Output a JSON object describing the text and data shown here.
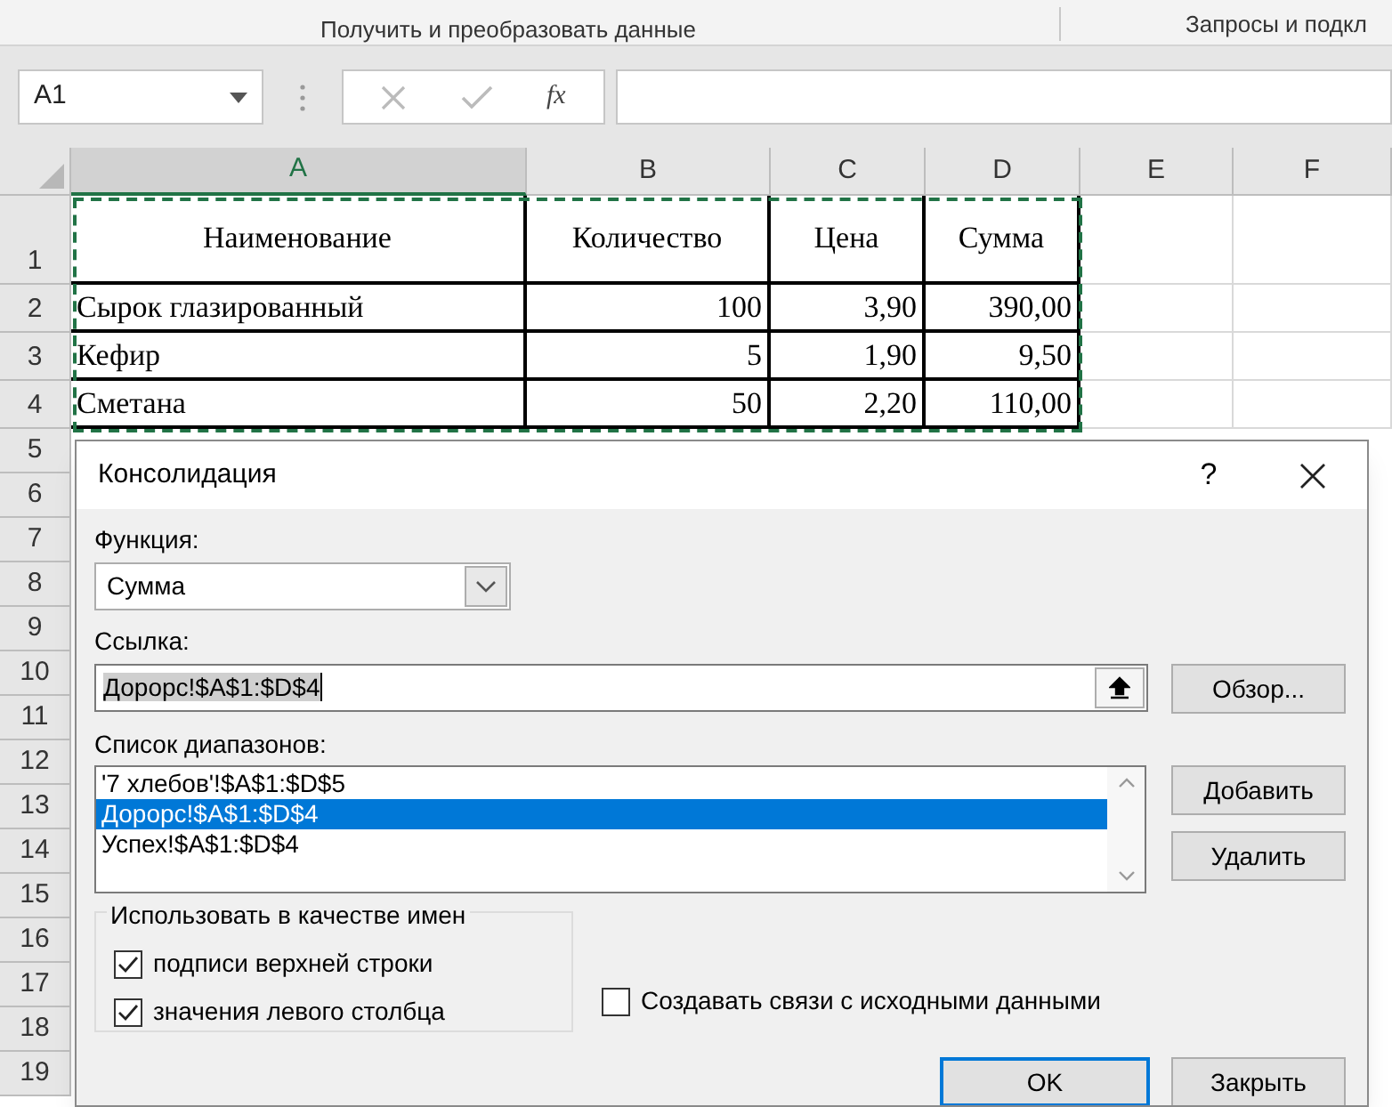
{
  "ribbon_groups": [
    "Получить и преобразовать данные",
    "Запросы и подкл"
  ],
  "name_box": "A1",
  "formula_bar": {
    "fx": "fx"
  },
  "columns": [
    {
      "label": "A",
      "selected": true
    },
    {
      "label": "B",
      "selected": false
    },
    {
      "label": "C",
      "selected": false
    },
    {
      "label": "D",
      "selected": false
    },
    {
      "label": "E",
      "selected": false
    },
    {
      "label": "F",
      "selected": false
    }
  ],
  "rows": [
    {
      "number": "1",
      "kind": "header",
      "cells": [
        "Наименование",
        "Количество",
        "Цена",
        "Сумма"
      ]
    },
    {
      "number": "2",
      "kind": "data",
      "cells": [
        "Сырок глазированный",
        "100",
        "3,90",
        "390,00"
      ]
    },
    {
      "number": "3",
      "kind": "data",
      "cells": [
        "Кефир",
        "5",
        "1,90",
        "9,50"
      ]
    },
    {
      "number": "4",
      "kind": "data",
      "cells": [
        "Сметана",
        "50",
        "2,20",
        "110,00"
      ]
    },
    {
      "number": "5",
      "kind": "empty",
      "cells": []
    },
    {
      "number": "6",
      "kind": "empty",
      "cells": []
    },
    {
      "number": "7",
      "kind": "empty",
      "cells": []
    },
    {
      "number": "8",
      "kind": "empty",
      "cells": []
    },
    {
      "number": "9",
      "kind": "empty",
      "cells": []
    },
    {
      "number": "10",
      "kind": "empty",
      "cells": []
    },
    {
      "number": "11",
      "kind": "empty",
      "cells": []
    },
    {
      "number": "12",
      "kind": "empty",
      "cells": []
    },
    {
      "number": "13",
      "kind": "empty",
      "cells": []
    },
    {
      "number": "14",
      "kind": "empty",
      "cells": []
    },
    {
      "number": "15",
      "kind": "empty",
      "cells": []
    },
    {
      "number": "16",
      "kind": "empty",
      "cells": []
    },
    {
      "number": "17",
      "kind": "empty",
      "cells": []
    },
    {
      "number": "18",
      "kind": "empty",
      "cells": []
    },
    {
      "number": "19",
      "kind": "empty",
      "cells": []
    }
  ],
  "dialog": {
    "title": "Консолидация",
    "help": "?",
    "function_label": "Функция:",
    "function_value": "Сумма",
    "reference_label": "Ссылка:",
    "reference_value": "Дорорс!$A$1:$D$4",
    "browse_button": "Обзор...",
    "ranges_label": "Список диапазонов:",
    "ranges": [
      {
        "text": "'7 хлебов'!$A$1:$D$5",
        "selected": false
      },
      {
        "text": "Дорорс!$A$1:$D$4",
        "selected": true
      },
      {
        "text": "Успех!$A$1:$D$4",
        "selected": false
      }
    ],
    "add_button": "Добавить",
    "delete_button": "Удалить",
    "names_group": "Использовать в качестве имен",
    "name_options": [
      {
        "label": "подписи верхней строки",
        "checked": true
      },
      {
        "label": "значения левого столбца",
        "checked": true
      }
    ],
    "link_option": {
      "label": "Создавать связи с исходными данными",
      "checked": false
    },
    "ok_button": "OK",
    "close_button": "Закрыть"
  }
}
